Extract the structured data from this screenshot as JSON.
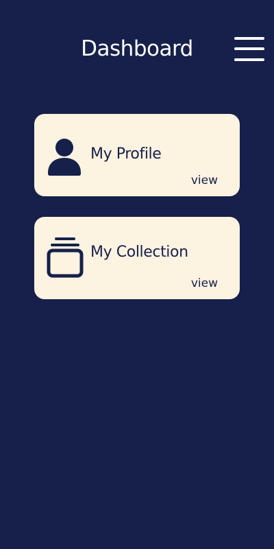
{
  "header": {
    "title": "Dashboard",
    "menu_icon": "hamburger-menu-icon"
  },
  "cards": [
    {
      "label": "My Profile",
      "link": "view",
      "icon": "user-icon"
    },
    {
      "label": "My Collection",
      "link": "view",
      "icon": "collection-stack-icon"
    }
  ],
  "colors": {
    "background": "#16204a",
    "card": "#fdf3e1",
    "text_dark": "#16204a",
    "text_light": "#ffffff"
  }
}
